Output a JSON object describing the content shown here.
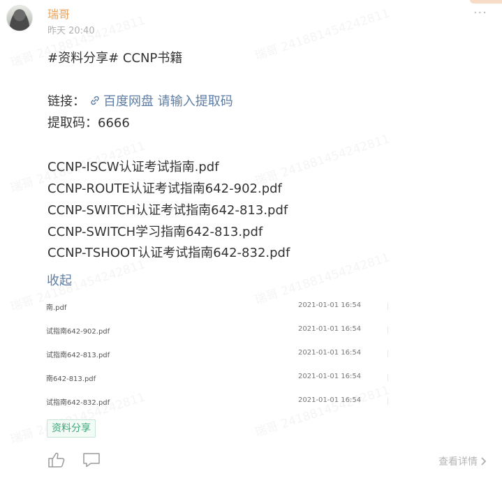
{
  "post": {
    "author": "瑞哥",
    "time": "昨天 20:40",
    "more_label": "···",
    "hashtag_line": "#资料分享# CCNP书籍",
    "link_label": "链接：",
    "link_text": "百度网盘 请输入提取码",
    "code_line": "提取码：6666",
    "books": [
      "CCNP-ISCW认证考试指南.pdf",
      "CCNP-ROUTE认证考试指南642-902.pdf",
      "CCNP-SWITCH认证考试指南642-813.pdf",
      "CCNP-SWITCH学习指南642-813.pdf",
      "CCNP-TSHOOT认证考试指南642-832.pdf"
    ],
    "collapse_label": "收起",
    "files": [
      {
        "name": "南.pdf",
        "date": "2021-01-01 16:54"
      },
      {
        "name": "试指南642-902.pdf",
        "date": "2021-01-01 16:54"
      },
      {
        "name": "试指南642-813.pdf",
        "date": "2021-01-01 16:54"
      },
      {
        "name": "南642-813.pdf",
        "date": "2021-01-01 16:54"
      },
      {
        "name": "试指南642-832.pdf",
        "date": "2021-01-01 16:54"
      }
    ],
    "tag": "资料分享",
    "details_label": "查看详情"
  },
  "watermark": {
    "text": "瑞哥 2418814542428​11"
  },
  "icons": {
    "link": "link-icon",
    "like": "thumbs-up-icon",
    "comment": "comment-icon",
    "more": "more-dots-icon",
    "arrow": "chevron-right-icon"
  },
  "colors": {
    "author": "#e8a15c",
    "link": "#5e7ea6",
    "tag": "#3aa778",
    "muted": "#b0b0b0"
  }
}
